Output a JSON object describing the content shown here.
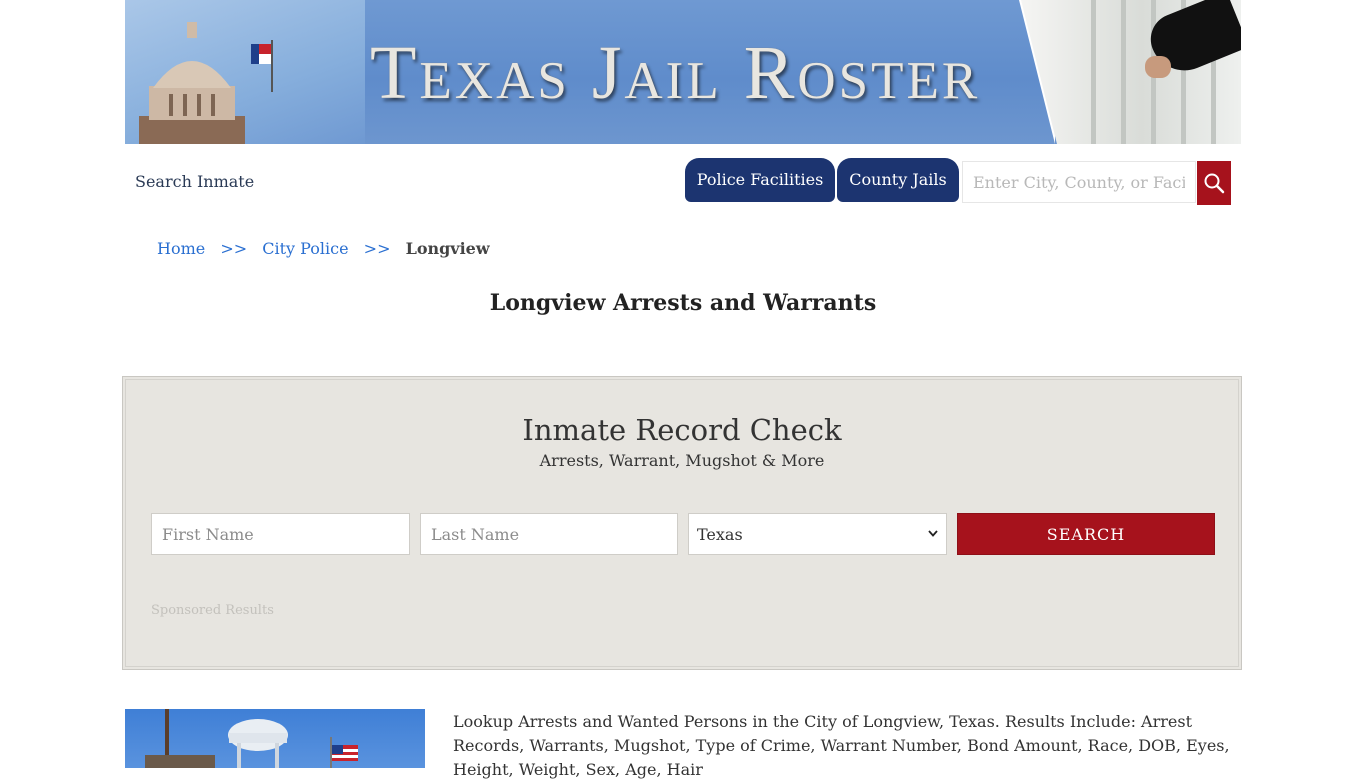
{
  "banner": {
    "title": "Texas Jail Roster"
  },
  "nav": {
    "search_inmate": "Search Inmate",
    "tabs": [
      {
        "label": "Police Facilities"
      },
      {
        "label": "County Jails"
      }
    ],
    "search_placeholder": "Enter City, County, or Facility"
  },
  "breadcrumb": {
    "items": [
      "Home",
      "City Police"
    ],
    "separator": ">>",
    "current": "Longview"
  },
  "page_title": "Longview Arrests and Warrants",
  "record_check": {
    "title": "Inmate Record Check",
    "subtitle": "Arrests, Warrant, Mugshot & More",
    "first_name_placeholder": "First Name",
    "last_name_placeholder": "Last Name",
    "state_selected": "Texas",
    "search_label": "SEARCH",
    "sponsored": "Sponsored Results"
  },
  "description": "Lookup Arrests and Wanted Persons in the City of Longview, Texas. Results Include: Arrest Records, Warrants, Mugshot, Type of Crime, Warrant Number, Bond Amount, Race, DOB, Eyes, Height, Weight, Sex, Age, Hair",
  "colors": {
    "navy": "#1c3470",
    "red": "#a6121c",
    "panel": "#e7e5e0",
    "link": "#2a6fd1"
  }
}
